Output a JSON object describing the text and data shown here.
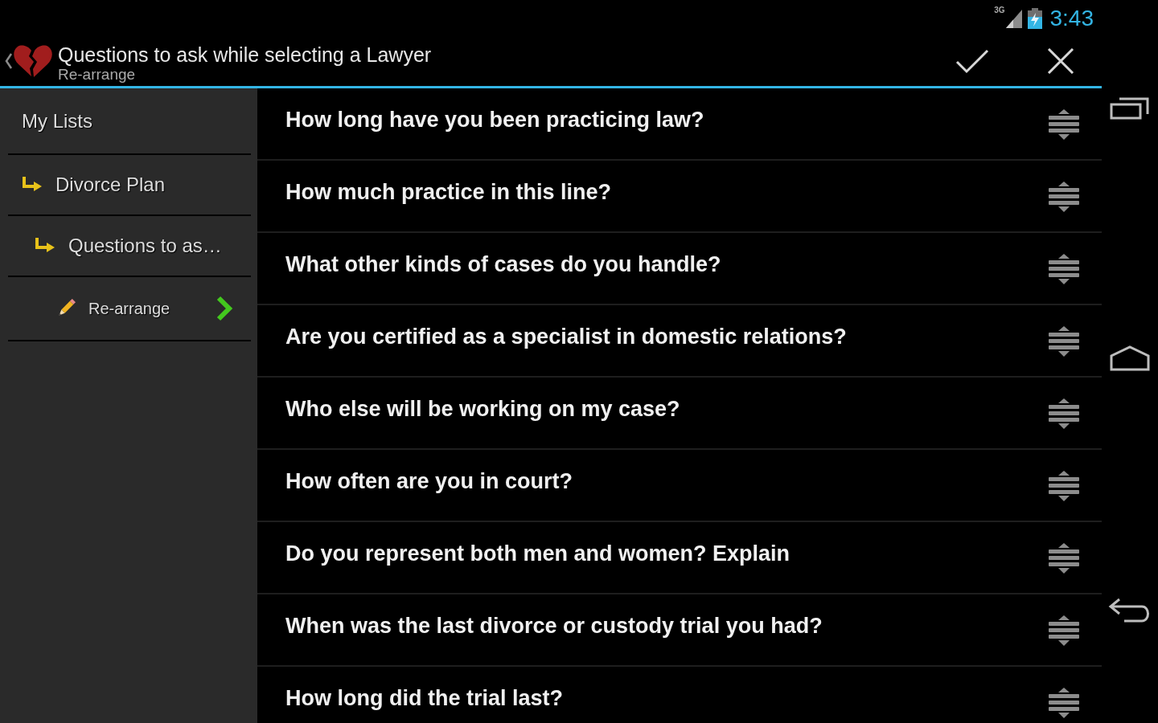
{
  "status_bar": {
    "network": "3G",
    "time": "3:43"
  },
  "action_bar": {
    "title": "Questions to ask while selecting a Lawyer",
    "subtitle": "Re-arrange"
  },
  "sidebar": {
    "header": "My Lists",
    "items": [
      {
        "label": "Divorce Plan",
        "kind": "list",
        "children": [
          {
            "label": "Questions to as…",
            "kind": "list",
            "children": [
              {
                "label": "Re-arrange",
                "kind": "action"
              }
            ]
          }
        ]
      }
    ]
  },
  "questions": [
    "How long have you been practicing law?",
    "How much practice in this line?",
    "What other kinds of cases do you handle?",
    "Are you certified as a specialist in domestic relations?",
    "Who else will be working on my case?",
    "How often are you in court?",
    "Do you represent both men and women? Explain",
    "When was the last divorce or custody trial you had?",
    "How long did the trial last?"
  ]
}
